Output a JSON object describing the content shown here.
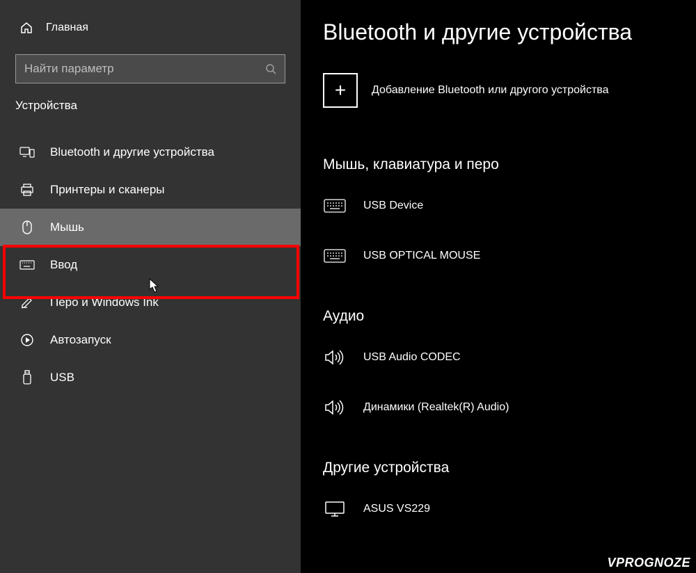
{
  "sidebar": {
    "home_label": "Главная",
    "search_placeholder": "Найти параметр",
    "category_label": "Устройства",
    "items": [
      {
        "label": "Bluetooth и другие устройства"
      },
      {
        "label": "Принтеры и сканеры"
      },
      {
        "label": "Мышь"
      },
      {
        "label": "Ввод"
      },
      {
        "label": "Перо и Windows Ink"
      },
      {
        "label": "Автозапуск"
      },
      {
        "label": "USB"
      }
    ]
  },
  "main": {
    "title": "Bluetooth и другие устройства",
    "add_label": "Добавление Bluetooth или другого устройства",
    "sections": [
      {
        "heading": "Мышь, клавиатура и перо",
        "devices": [
          {
            "name": "USB Device"
          },
          {
            "name": "USB OPTICAL MOUSE"
          }
        ]
      },
      {
        "heading": "Аудио",
        "devices": [
          {
            "name": "USB Audio CODEC"
          },
          {
            "name": "Динамики (Realtek(R) Audio)"
          }
        ]
      },
      {
        "heading": "Другие устройства",
        "devices": [
          {
            "name": "ASUS VS229"
          }
        ]
      }
    ]
  },
  "watermark": "VPROGNOZE"
}
